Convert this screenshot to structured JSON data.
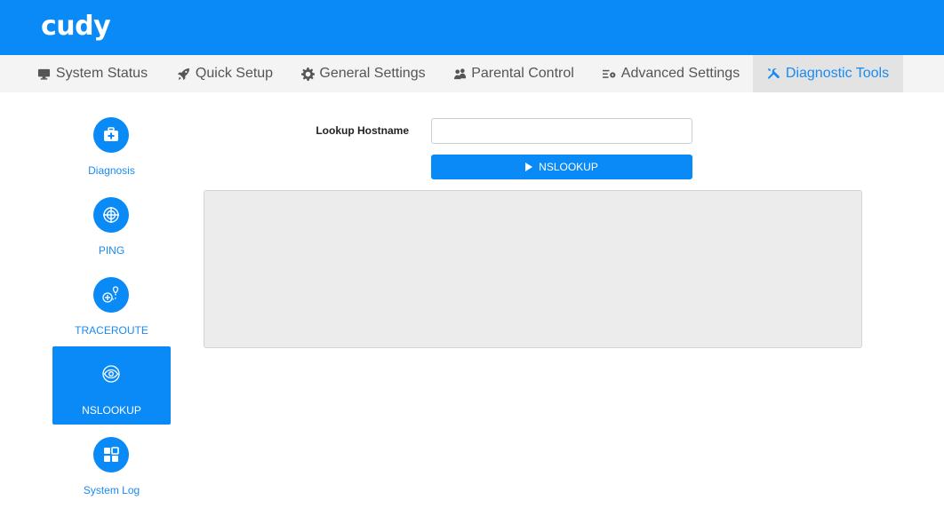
{
  "header": {
    "logo": "cudy",
    "brand_color": "#0a8af6"
  },
  "topnav": {
    "items": [
      {
        "label": "System Status",
        "icon": "monitor-icon"
      },
      {
        "label": "Quick Setup",
        "icon": "rocket-icon"
      },
      {
        "label": "General Settings",
        "icon": "gear-icon"
      },
      {
        "label": "Parental Control",
        "icon": "users-icon"
      },
      {
        "label": "Advanced Settings",
        "icon": "list-gear-icon"
      },
      {
        "label": "Diagnostic Tools",
        "icon": "tools-icon",
        "active": true
      }
    ]
  },
  "sidebar": {
    "items": [
      {
        "label": "Diagnosis",
        "icon": "medkit-icon"
      },
      {
        "label": "PING",
        "icon": "crosshair-icon"
      },
      {
        "label": "TRACEROUTE",
        "icon": "route-icon"
      },
      {
        "label": "NSLOOKUP",
        "icon": "eye-icon",
        "active": true
      },
      {
        "label": "System Log",
        "icon": "grid-icon"
      }
    ]
  },
  "form": {
    "hostname_label": "Lookup Hostname",
    "hostname_value": "",
    "hostname_placeholder": "",
    "button_label": "NSLOOKUP"
  },
  "output": {
    "text": ""
  }
}
